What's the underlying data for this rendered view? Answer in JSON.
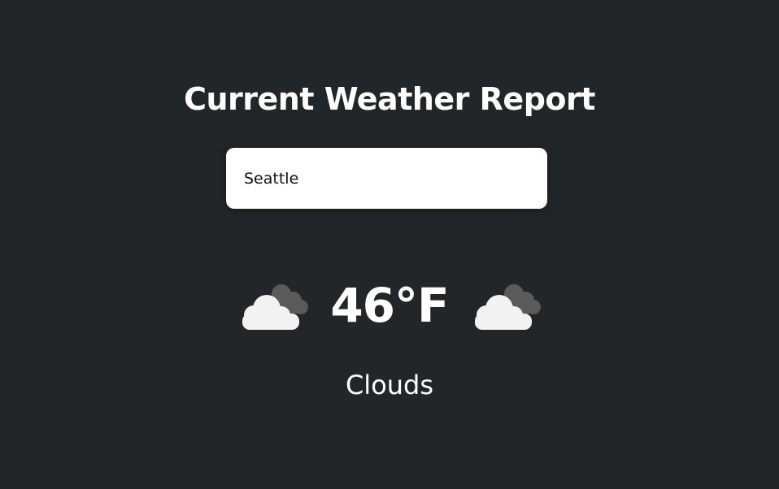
{
  "header": {
    "title": "Current Weather Report"
  },
  "search": {
    "value": "Seattle",
    "placeholder": ""
  },
  "weather": {
    "temperature": "46°F",
    "condition": "Clouds",
    "icon_left": "cloud-icon",
    "icon_right": "cloud-icon"
  },
  "colors": {
    "background": "#232629",
    "text": "#ffffff",
    "input_background": "#ffffff",
    "cloud_front": "#f2f2f2",
    "cloud_back": "#5c5c5c"
  }
}
